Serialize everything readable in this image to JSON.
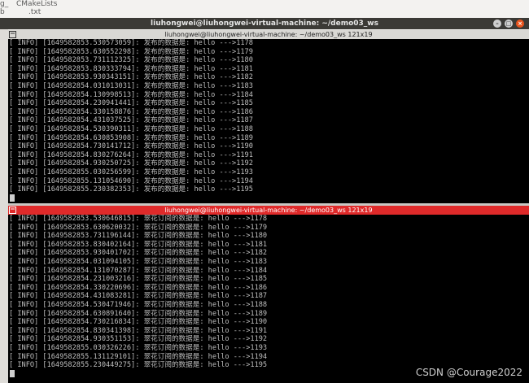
{
  "desktop": {
    "icon1_line1": "g_",
    "icon1_line2": "b",
    "icon2_line1": "CMakeLists",
    "icon2_line2": ".txt"
  },
  "window": {
    "title": "liuhongwei@liuhongwei-virtual-machine: ~/demo03_ws",
    "btn_min": "–",
    "btn_max": "□",
    "btn_close": "×"
  },
  "panes": [
    {
      "title": "liuhongwei@liuhongwei-virtual-machine: ~/demo03_ws 121x19",
      "lines": [
        "[ INFO] [1649582853.530573059]: 发布的数据是: hello --->1178",
        "[ INFO] [1649582853.630552298]: 发布的数据是: hello --->1179",
        "[ INFO] [1649582853.731112325]: 发布的数据是: hello --->1180",
        "[ INFO] [1649582853.830333794]: 发布的数据是: hello --->1181",
        "[ INFO] [1649582853.930343151]: 发布的数据是: hello --->1182",
        "[ INFO] [1649582854.031013031]: 发布的数据是: hello --->1183",
        "[ INFO] [1649582854.130998513]: 发布的数据是: hello --->1184",
        "[ INFO] [1649582854.230941441]: 发布的数据是: hello --->1185",
        "[ INFO] [1649582854.330158876]: 发布的数据是: hello --->1186",
        "[ INFO] [1649582854.431037525]: 发布的数据是: hello --->1187",
        "[ INFO] [1649582854.530390311]: 发布的数据是: hello --->1188",
        "[ INFO] [1649582854.630853908]: 发布的数据是: hello --->1189",
        "[ INFO] [1649582854.730141712]: 发布的数据是: hello --->1190",
        "[ INFO] [1649582854.830276264]: 发布的数据是: hello --->1191",
        "[ INFO] [1649582854.930250725]: 发布的数据是: hello --->1192",
        "[ INFO] [1649582855.030256599]: 发布的数据是: hello --->1193",
        "[ INFO] [1649582855.131054690]: 发布的数据是: hello --->1194",
        "[ INFO] [1649582855.230382353]: 发布的数据是: hello --->1195"
      ]
    },
    {
      "title": "liuhongwei@liuhongwei-virtual-machine: ~/demo03_ws 121x19",
      "lines": [
        "[ INFO] [1649582853.530646815]: 翠花订阅的数据是: hello --->1178",
        "[ INFO] [1649582853.630620032]: 翠花订阅的数据是: hello --->1179",
        "[ INFO] [1649582853.731196144]: 翠花订阅的数据是: hello --->1180",
        "[ INFO] [1649582853.830402164]: 翠花订阅的数据是: hello --->1181",
        "[ INFO] [1649582853.930401702]: 翠花订阅的数据是: hello --->1182",
        "[ INFO] [1649582854.031094105]: 翠花订阅的数据是: hello --->1183",
        "[ INFO] [1649582854.131070287]: 翠花订阅的数据是: hello --->1184",
        "[ INFO] [1649582854.231003216]: 翠花订阅的数据是: hello --->1185",
        "[ INFO] [1649582854.330220696]: 翠花订阅的数据是: hello --->1186",
        "[ INFO] [1649582854.431083281]: 翠花订阅的数据是: hello --->1187",
        "[ INFO] [1649582854.530471946]: 翠花订阅的数据是: hello --->1188",
        "[ INFO] [1649582854.630891640]: 翠花订阅的数据是: hello --->1189",
        "[ INFO] [1649582854.730216834]: 翠花订阅的数据是: hello --->1190",
        "[ INFO] [1649582854.830341398]: 翠花订阅的数据是: hello --->1191",
        "[ INFO] [1649582854.930351153]: 翠花订阅的数据是: hello --->1192",
        "[ INFO] [1649582855.030326226]: 翠花订阅的数据是: hello --->1193",
        "[ INFO] [1649582855.131129101]: 翠花订阅的数据是: hello --->1194",
        "[ INFO] [1649582855.230449275]: 翠花订阅的数据是: hello --->1195"
      ]
    }
  ],
  "watermark": "CSDN @Courage2022",
  "colors": {
    "active_pane_title": "#df2a2a",
    "terminal_bg": "#000000",
    "terminal_fg": "#bfbfbf"
  }
}
